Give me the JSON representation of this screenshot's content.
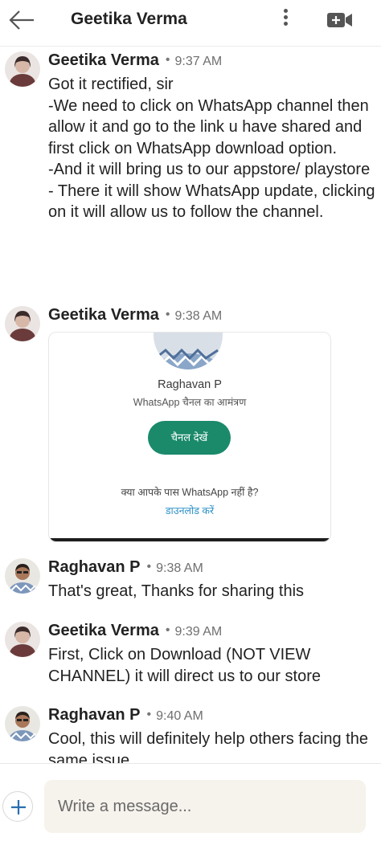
{
  "header": {
    "title": "Geetika Verma",
    "back_icon": "arrow-left-icon",
    "menu_icon": "more-vertical-icon",
    "video_icon": "video-call-icon"
  },
  "messages": [
    {
      "sender": "Geetika Verma",
      "time": "9:37 AM",
      "avatar_icon": "profile-photo",
      "text": "Got it rectified, sir\n-We need to click on WhatsApp channel then allow it and go to the link u have shared and first click on WhatsApp download option.\n-And it will bring us to our appstore/ playstore\n- There it will show WhatsApp update, clicking on it will allow us to follow the channel."
    },
    {
      "sender": "Geetika Verma",
      "time": "9:38 AM",
      "avatar_icon": "profile-photo",
      "card": {
        "name": "Raghavan P",
        "subtitle": "WhatsApp चैनल का आमंत्रण",
        "button": "चैनल देखें",
        "question": "क्या आपके पास WhatsApp नहीं है?",
        "link": "डाउनलोड करें",
        "button_color": "#1a8a6b",
        "link_color": "#2a8fc7"
      }
    },
    {
      "sender": "Raghavan P",
      "time": "9:38 AM",
      "avatar_icon": "profile-photo",
      "text": "That's great, Thanks for sharing this"
    },
    {
      "sender": "Geetika Verma",
      "time": "9:39 AM",
      "avatar_icon": "profile-photo",
      "text": "First, Click on Download (NOT VIEW CHANNEL) it will direct us to our store"
    },
    {
      "sender": "Raghavan P",
      "time": "9:40 AM",
      "avatar_icon": "profile-photo",
      "text": "Cool, this will definitely help others facing the same issue"
    }
  ],
  "composer": {
    "placeholder": "Write a message...",
    "attach_icon": "plus-icon"
  },
  "colors": {
    "accent_green": "#1a8a6b",
    "composer_bg": "#f6f2ec"
  }
}
